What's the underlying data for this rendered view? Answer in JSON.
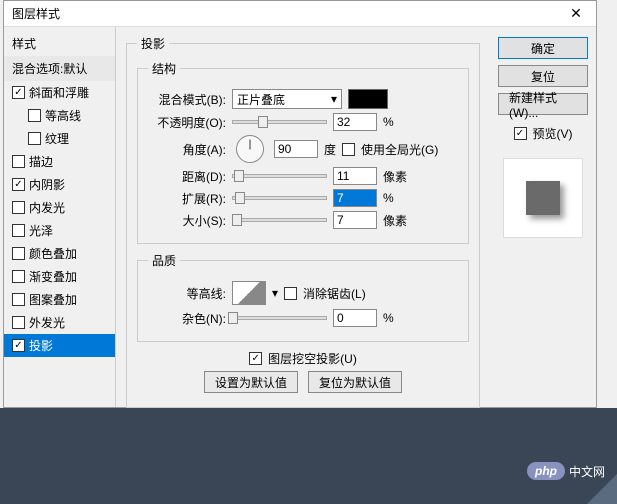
{
  "title": "图层样式",
  "sidebar": {
    "head": "样式",
    "blend": "混合选项:默认",
    "items": [
      {
        "label": "斜面和浮雕",
        "checked": true,
        "selected": false,
        "indent": false
      },
      {
        "label": "等高线",
        "checked": false,
        "selected": false,
        "indent": true
      },
      {
        "label": "纹理",
        "checked": false,
        "selected": false,
        "indent": true
      },
      {
        "label": "描边",
        "checked": false,
        "selected": false,
        "indent": false
      },
      {
        "label": "内阴影",
        "checked": true,
        "selected": false,
        "indent": false
      },
      {
        "label": "内发光",
        "checked": false,
        "selected": false,
        "indent": false
      },
      {
        "label": "光泽",
        "checked": false,
        "selected": false,
        "indent": false
      },
      {
        "label": "颜色叠加",
        "checked": false,
        "selected": false,
        "indent": false
      },
      {
        "label": "渐变叠加",
        "checked": false,
        "selected": false,
        "indent": false
      },
      {
        "label": "图案叠加",
        "checked": false,
        "selected": false,
        "indent": false
      },
      {
        "label": "外发光",
        "checked": false,
        "selected": false,
        "indent": false
      },
      {
        "label": "投影",
        "checked": true,
        "selected": true,
        "indent": false
      }
    ]
  },
  "panel": {
    "title": "投影",
    "structure": {
      "legend": "结构",
      "blend_label": "混合模式(B):",
      "blend_value": "正片叠底",
      "opacity_label": "不透明度(O):",
      "opacity_value": "32",
      "pct": "%",
      "angle_label": "角度(A):",
      "angle_value": "90",
      "deg": "度",
      "global_light": "使用全局光(G)",
      "distance_label": "距离(D):",
      "distance_value": "11",
      "px": "像素",
      "spread_label": "扩展(R):",
      "spread_value": "7",
      "size_label": "大小(S):",
      "size_value": "7"
    },
    "quality": {
      "legend": "品质",
      "contour_label": "等高线:",
      "antialias": "消除锯齿(L)",
      "noise_label": "杂色(N):",
      "noise_value": "0"
    },
    "knockout": "图层挖空投影(U)",
    "make_default": "设置为默认值",
    "reset_default": "复位为默认值"
  },
  "right": {
    "ok": "确定",
    "reset": "复位",
    "new_style": "新建样式(W)...",
    "preview": "预览(V)"
  },
  "watermark": {
    "php": "php",
    "cn": "中文网"
  }
}
